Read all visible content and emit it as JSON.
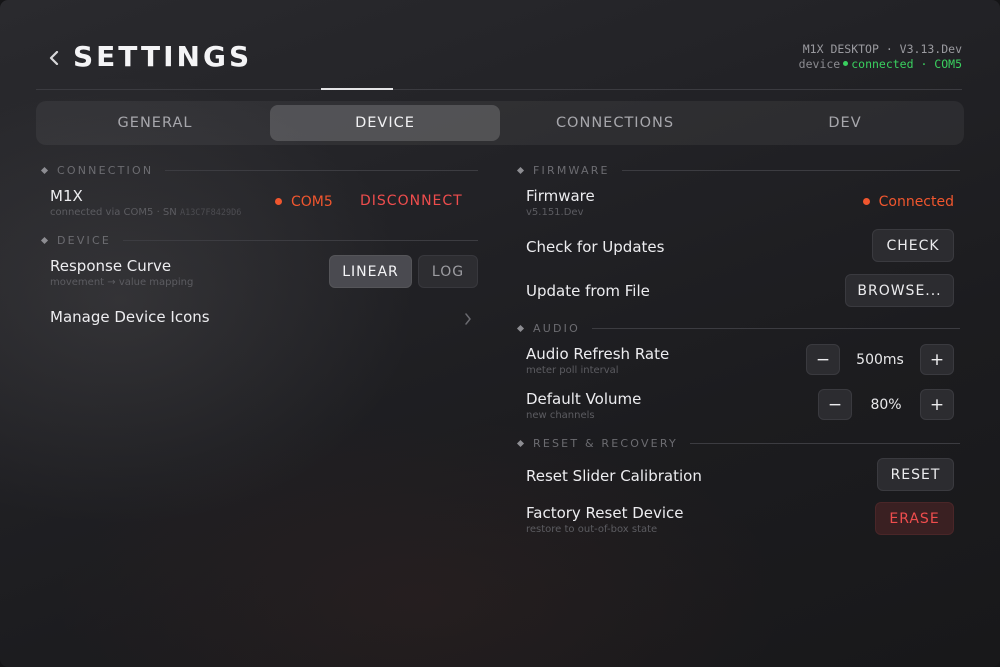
{
  "header": {
    "title": "SETTINGS",
    "app_version": "M1X DESKTOP · V3.13.Dev",
    "status_prefix": "device",
    "status_text": "connected · COM5"
  },
  "tabs": [
    {
      "label": "GENERAL"
    },
    {
      "label": "DEVICE"
    },
    {
      "label": "CONNECTIONS"
    },
    {
      "label": "DEV"
    }
  ],
  "sections": {
    "connection": {
      "title": "CONNECTION",
      "device_name": "M1X",
      "device_sub": "connected via COM5 · SN",
      "serial": "A13C7F8429D6",
      "port": "COM5",
      "disconnect_label": "DISCONNECT"
    },
    "device": {
      "title": "DEVICE",
      "response_curve_label": "Response Curve",
      "response_curve_sub": "movement → value mapping",
      "linear_label": "LINEAR",
      "log_label": "LOG",
      "manage_icons_label": "Manage Device Icons"
    },
    "firmware": {
      "title": "FIRMWARE",
      "firmware_label": "Firmware",
      "firmware_version": "v5.151.Dev",
      "firmware_status": "Connected",
      "check_updates_label": "Check for Updates",
      "check_button": "CHECK",
      "update_file_label": "Update from File",
      "browse_button": "BROWSE..."
    },
    "audio": {
      "title": "AUDIO",
      "refresh_label": "Audio Refresh Rate",
      "refresh_sub": "meter poll interval",
      "refresh_value": "500ms",
      "volume_label": "Default Volume",
      "volume_sub": "new channels",
      "volume_value": "80%",
      "minus": "−",
      "plus": "+"
    },
    "reset": {
      "title": "RESET & RECOVERY",
      "slider_label": "Reset Slider Calibration",
      "reset_button": "RESET",
      "factory_label": "Factory Reset Device",
      "factory_sub": "restore to out-of-box state",
      "erase_button": "ERASE"
    }
  },
  "colors": {
    "accent_green": "#3ad05f",
    "accent_orange": "#f0562e",
    "danger_red": "#ef4d4d"
  }
}
